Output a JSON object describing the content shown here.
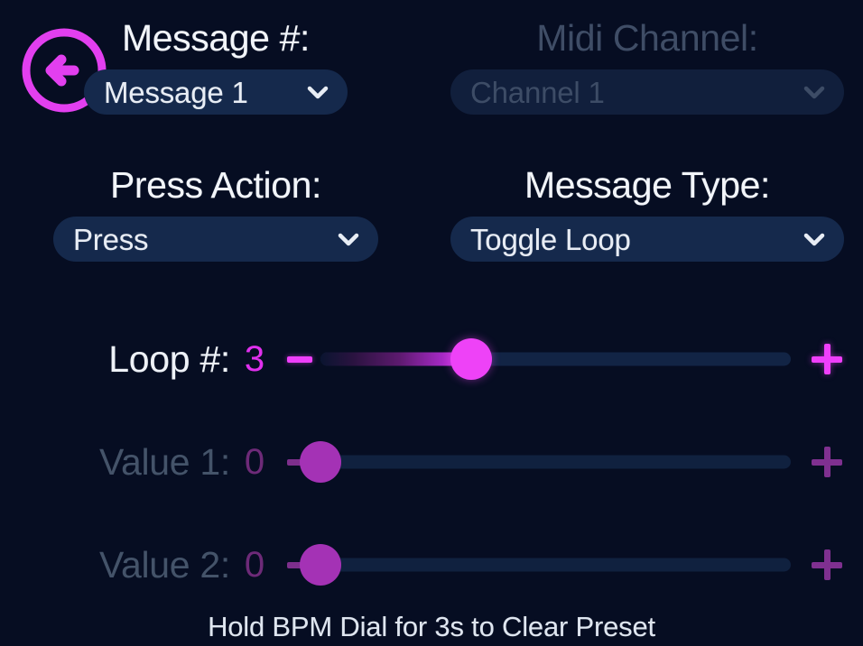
{
  "theme": {
    "background": "#060d22",
    "accent": "#ef3ffb",
    "accent_dim": "#7f3090",
    "field_background": "#15294c",
    "field_background_dim": "#111f3c",
    "text": "#f2f5fa",
    "text_dim": "#3f4d66",
    "track": "#122445"
  },
  "nav": {
    "back_icon": "circle-arrow-left-icon"
  },
  "fields": {
    "message_number": {
      "label": "Message #:",
      "value": "Message 1",
      "chevron_icon": "chevron-down-icon",
      "enabled": true
    },
    "midi_channel": {
      "label": "Midi Channel:",
      "value": "Channel 1",
      "chevron_icon": "chevron-down-icon",
      "enabled": false
    },
    "press_action": {
      "label": "Press Action:",
      "value": "Press",
      "chevron_icon": "chevron-down-icon",
      "enabled": true
    },
    "message_type": {
      "label": "Message Type:",
      "value": "Toggle Loop",
      "chevron_icon": "chevron-down-icon",
      "enabled": true
    }
  },
  "sliders": [
    {
      "label": "Loop #:",
      "value": "3",
      "percent": 32,
      "minus_icon": "minus-icon",
      "plus_icon": "plus-icon",
      "enabled": true
    },
    {
      "label": "Value 1:",
      "value": "0",
      "percent": 0,
      "minus_icon": "minus-icon",
      "plus_icon": "plus-icon",
      "enabled": false
    },
    {
      "label": "Value 2:",
      "value": "0",
      "percent": 0,
      "minus_icon": "minus-icon",
      "plus_icon": "plus-icon",
      "enabled": false
    }
  ],
  "footer": {
    "hint": "Hold BPM Dial for 3s to Clear Preset"
  }
}
